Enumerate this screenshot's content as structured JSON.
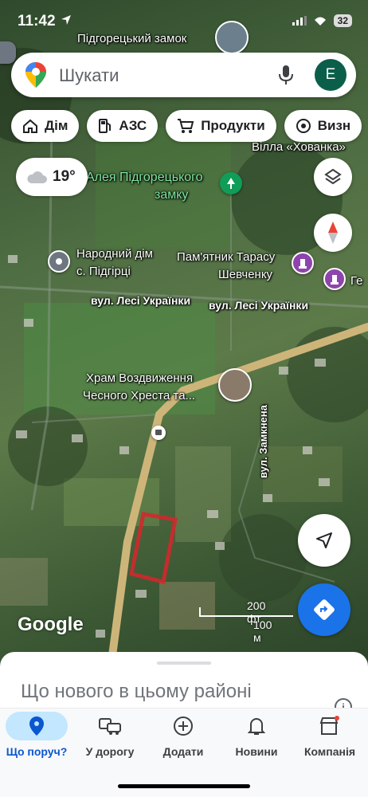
{
  "status_bar": {
    "time": "11:42",
    "battery": "32"
  },
  "map": {
    "top_label": "Підгорецький замок",
    "villa_label": "Вілла «Хованка»",
    "alley_label_1": "Алея Підгорецького",
    "alley_label_2": "замку",
    "house_label_1": "Народний дім",
    "house_label_2": "с. Підгірці",
    "monument_label_1": "Пам'ятник Тарасу",
    "monument_label_2": "Шевченку",
    "partial_label": "Ге",
    "street_1": "вул. Лесі Українки",
    "street_2": "вул. Лесі Українки",
    "temple_label_1": "Храм Воздвиження",
    "temple_label_2": "Чесного Хреста та...",
    "street_vertical": "вул. Замкнена",
    "google": "Google",
    "scale_ft": "200 фт",
    "scale_m": "100 м",
    "colors": {
      "selection": "#d7262b",
      "road": "#cdb57a",
      "pin_purple": "#8e44ad",
      "pin_green": "#0f9d58"
    }
  },
  "search": {
    "placeholder": "Шукати",
    "avatar_letter": "E"
  },
  "chips": [
    {
      "label": "Дім",
      "icon": "home-icon"
    },
    {
      "label": "АЗС",
      "icon": "gas-station-icon"
    },
    {
      "label": "Продукти",
      "icon": "cart-icon"
    },
    {
      "label": "Визн",
      "icon": "landmark-icon"
    }
  ],
  "weather": {
    "temp": "19°",
    "icon": "cloud-icon"
  },
  "sheet": {
    "title": "Що нового в цьому районі"
  },
  "nav": [
    {
      "label": "Що поруч?",
      "icon": "location-pin-icon",
      "active": true
    },
    {
      "label": "У дорогу",
      "icon": "commute-icon",
      "active": false
    },
    {
      "label": "Додати",
      "icon": "add-circle-icon",
      "active": false
    },
    {
      "label": "Новини",
      "icon": "bell-icon",
      "active": false
    },
    {
      "label": "Компанія",
      "icon": "store-icon",
      "active": false
    }
  ]
}
